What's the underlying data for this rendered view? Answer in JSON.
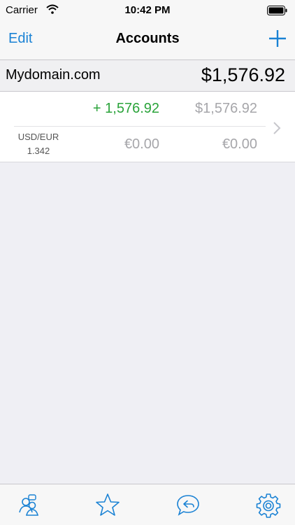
{
  "status_bar": {
    "carrier": "Carrier",
    "time": "10:42 PM"
  },
  "nav": {
    "edit_label": "Edit",
    "title": "Accounts",
    "add_icon": "plus-icon"
  },
  "section": {
    "name": "Mydomain.com",
    "total": "$1,576.92"
  },
  "account": {
    "change": "+ 1,576.92",
    "total": "$1,576.92",
    "currency_pair": "USD/EUR",
    "rate": "1.342",
    "eur_value": "€0.00",
    "eur_total": "€0.00"
  },
  "tab_bar": {
    "icons": [
      "contacts-icon",
      "star-icon",
      "reply-chat-icon",
      "gear-icon"
    ]
  },
  "colors": {
    "accent": "#1a82d4",
    "positive": "#2aa33a",
    "muted": "#a6a6aa",
    "background": "#efeff4"
  }
}
